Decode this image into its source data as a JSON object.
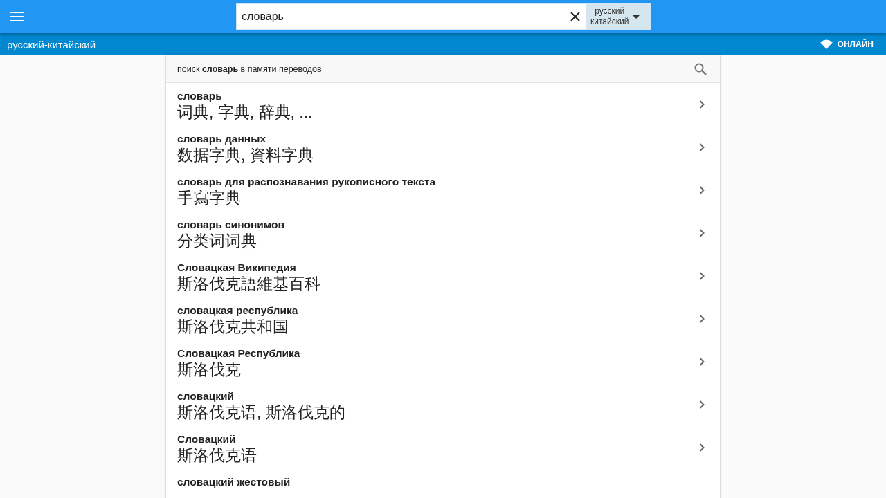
{
  "search": {
    "value": "словарь"
  },
  "language_selector": {
    "source": "русский",
    "target": "китайский"
  },
  "subheader": {
    "title": "русский-китайский",
    "status": "ОНЛАЙН"
  },
  "memory_search": {
    "text": "поиск **словарь** в памяти переводов"
  },
  "results": [
    {
      "term": "словарь",
      "translation": "词典, 字典, 辞典, ..."
    },
    {
      "term": "словарь данных",
      "translation": "数据字典, 資料字典"
    },
    {
      "term": "словарь для распознавания рукописного текста",
      "translation": "手寫字典"
    },
    {
      "term": "словарь синонимов",
      "translation": "分类词词典"
    },
    {
      "term": "Словацкая Википедия",
      "translation": "斯洛伐克語維基百科"
    },
    {
      "term": "словацкая республика",
      "translation": "斯洛伐克共和国"
    },
    {
      "term": "Словацкая Республика",
      "translation": "斯洛伐克"
    },
    {
      "term": "словацкий",
      "translation": "斯洛伐克语, 斯洛伐克的"
    },
    {
      "term": "Словацкий",
      "translation": "斯洛伐克语"
    },
    {
      "term": "словацкий жестовый"
    }
  ]
}
